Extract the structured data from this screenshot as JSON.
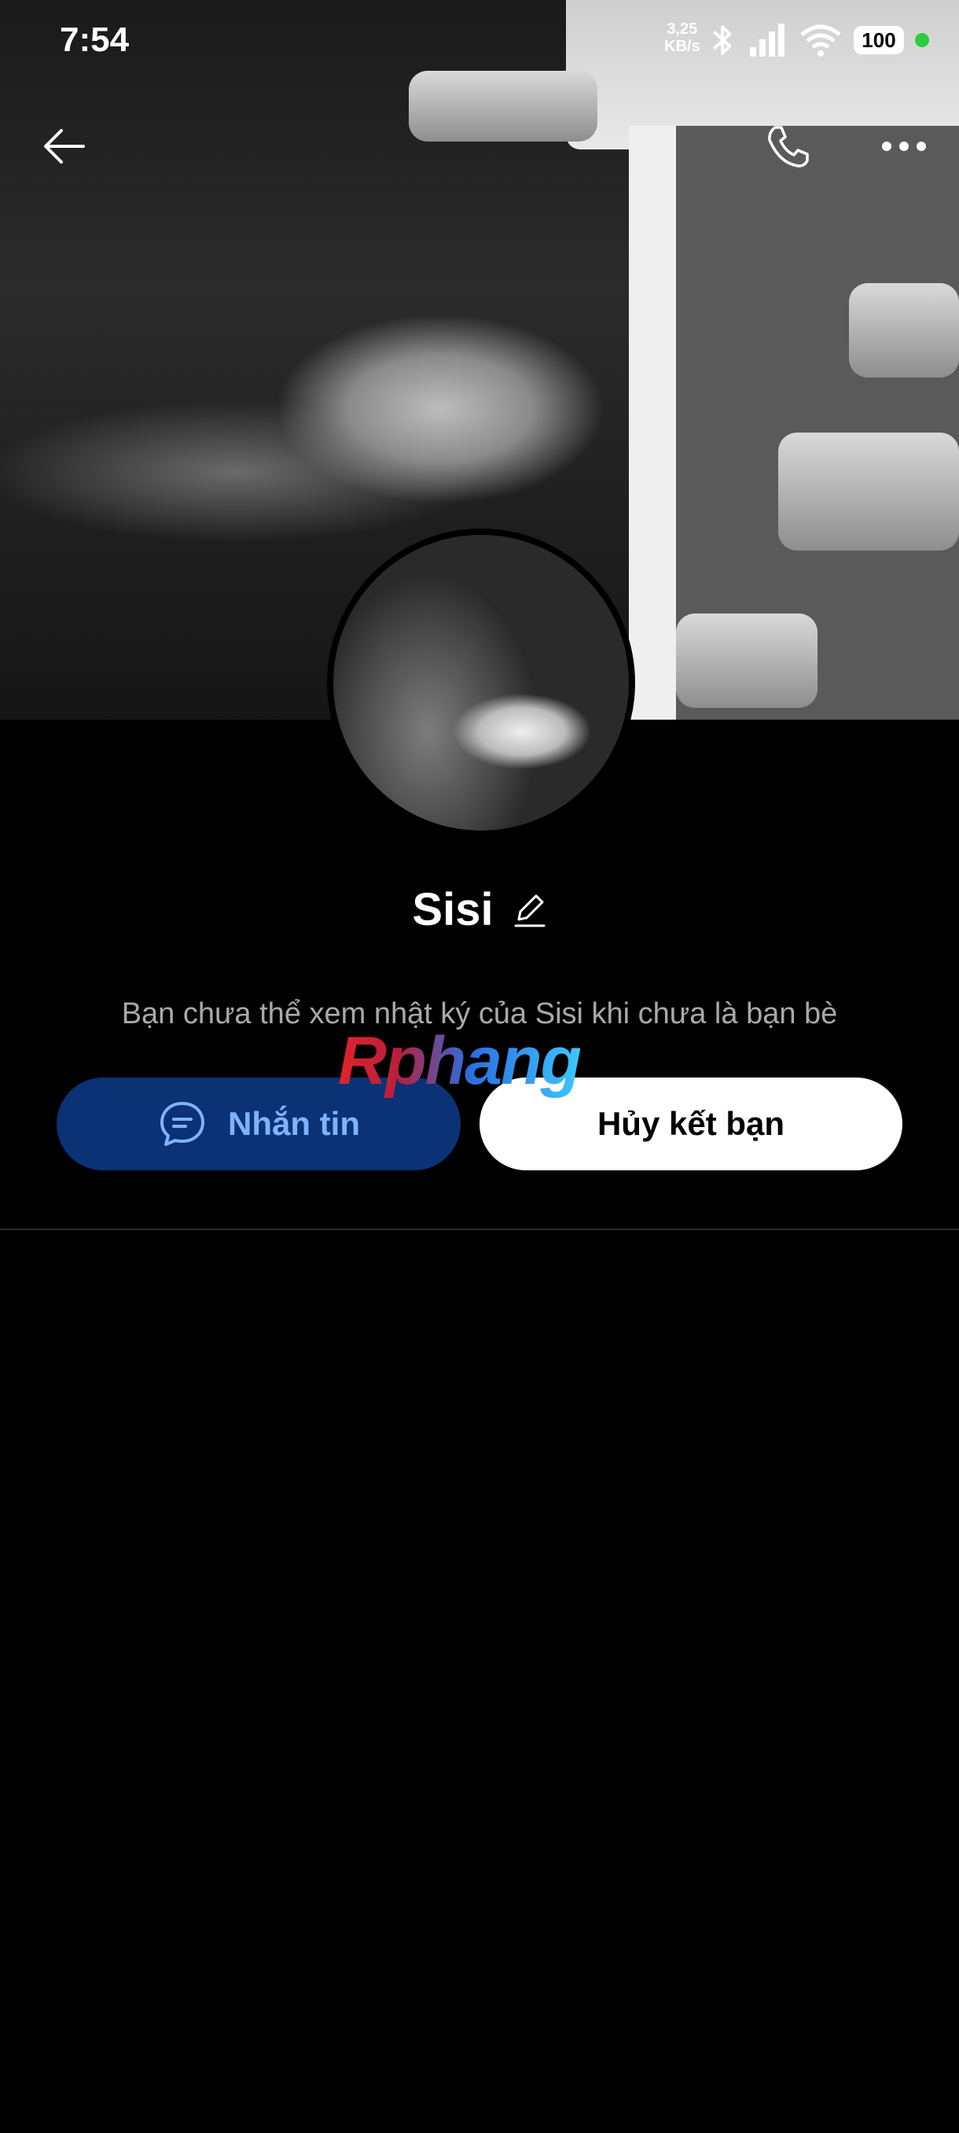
{
  "status_bar": {
    "time": "7:54",
    "network_speed_value": "3,25",
    "network_speed_unit": "KB/s",
    "battery": "100",
    "icons": [
      "bluetooth-icon",
      "signal-icon",
      "wifi-icon",
      "battery-icon",
      "privacy-dot"
    ],
    "privacy_dot_color": "#2ecc40"
  },
  "header": {
    "back_icon": "arrow-left-icon",
    "call_icon": "phone-icon",
    "more_icon": "more-dots-icon"
  },
  "profile": {
    "name": "Sisi",
    "edit_icon": "pencil-icon",
    "notice": "Bạn chưa thể xem nhật ký của Sisi khi chưa là bạn bè"
  },
  "actions": {
    "message_label": "Nhắn tin",
    "message_icon": "chat-bubble-icon",
    "unfriend_label": "Hủy kết bạn"
  },
  "watermark": "Rphang",
  "colors": {
    "message_button_bg": "#0a3275",
    "message_button_text": "#7fb2ff",
    "unfriend_button_bg": "#ffffff",
    "notice_text": "#a9a9a9"
  }
}
